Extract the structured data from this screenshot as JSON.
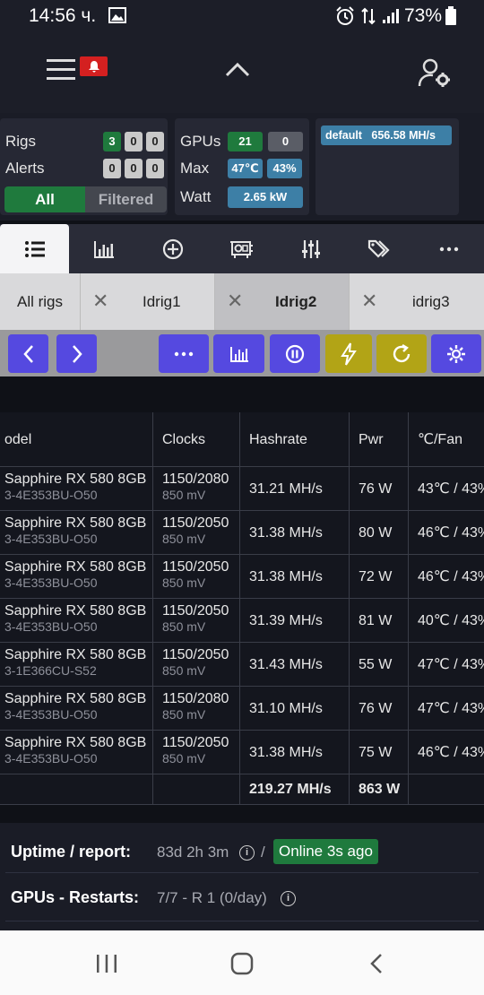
{
  "status_bar": {
    "time": "14:56 ч.",
    "battery": "73%"
  },
  "summary": {
    "rigs_label": "Rigs",
    "rigs_counts": [
      "3",
      "0",
      "0"
    ],
    "alerts_label": "Alerts",
    "alerts_counts": [
      "0",
      "0",
      "0"
    ],
    "filter_all": "All",
    "filter_filtered": "Filtered",
    "gpus_label": "GPUs",
    "gpus_counts": [
      "21",
      "0"
    ],
    "max_label": "Max",
    "max_temp": "47℃",
    "max_fan": "43%",
    "watt_label": "Watt",
    "watt_value": "2.65 kW",
    "pool_name": "default",
    "pool_hashrate": "656.58 MH/s"
  },
  "rig_tabs": {
    "all": "All rigs",
    "rigs": [
      "Idrig1",
      "Idrig2",
      "idrig3"
    ]
  },
  "table": {
    "headers": [
      "odel",
      "Clocks",
      "Hashrate",
      "Pwr",
      "℃/Fan"
    ],
    "rows": [
      {
        "model": "Sapphire RX 580 8GB",
        "sub": "3-4E353BU-O50",
        "clocks": "1150/2080",
        "mv": "850 mV",
        "hashrate": "31.21 MH/s",
        "pwr": "76 W",
        "tempfan": "43℃ / 43%"
      },
      {
        "model": "Sapphire RX 580 8GB",
        "sub": "3-4E353BU-O50",
        "clocks": "1150/2050",
        "mv": "850 mV",
        "hashrate": "31.38 MH/s",
        "pwr": "80 W",
        "tempfan": "46℃ / 43%"
      },
      {
        "model": "Sapphire RX 580 8GB",
        "sub": "3-4E353BU-O50",
        "clocks": "1150/2050",
        "mv": "850 mV",
        "hashrate": "31.38 MH/s",
        "pwr": "72 W",
        "tempfan": "46℃ / 43%"
      },
      {
        "model": "Sapphire RX 580 8GB",
        "sub": "3-4E353BU-O50",
        "clocks": "1150/2050",
        "mv": "850 mV",
        "hashrate": "31.39 MH/s",
        "pwr": "81 W",
        "tempfan": "40℃ / 43%"
      },
      {
        "model": "Sapphire RX 580 8GB",
        "sub": "3-1E366CU-S52",
        "clocks": "1150/2050",
        "mv": "850 mV",
        "hashrate": "31.43 MH/s",
        "pwr": "55 W",
        "tempfan": "47℃ / 43%"
      },
      {
        "model": "Sapphire RX 580 8GB",
        "sub": "3-4E353BU-O50",
        "clocks": "1150/2080",
        "mv": "850 mV",
        "hashrate": "31.10 MH/s",
        "pwr": "76 W",
        "tempfan": "47℃ / 43%"
      },
      {
        "model": "Sapphire RX 580 8GB",
        "sub": "3-4E353BU-O50",
        "clocks": "1150/2050",
        "mv": "850 mV",
        "hashrate": "31.38 MH/s",
        "pwr": "75 W",
        "tempfan": "46℃ / 43%"
      }
    ],
    "total_hashrate": "219.27 MH/s",
    "total_pwr": "863 W"
  },
  "info": {
    "uptime_label": "Uptime / report:",
    "uptime_value": "83d 2h 3m",
    "separator": "/",
    "online_badge": "Online 3s ago",
    "restarts_label": "GPUs - Restarts:",
    "restarts_value": "7/7 - R 1 (0/day)"
  },
  "colors": {
    "accent_purple": "#5549e0",
    "accent_olive": "#b2a416",
    "status_green": "#1f7a3d",
    "badge_blue": "#3d7fa6",
    "alert_red": "#d42020"
  }
}
